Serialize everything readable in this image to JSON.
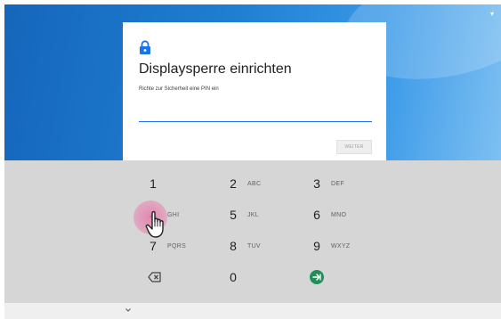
{
  "dialog": {
    "title": "Displaysperre einrichten",
    "subtitle": "Richte zur Sicherheit eine PIN ein",
    "pin_value": "",
    "next_label": "WEITER"
  },
  "keypad": {
    "keys": [
      {
        "num": "1",
        "letters": ""
      },
      {
        "num": "2",
        "letters": "ABC"
      },
      {
        "num": "3",
        "letters": "DEF"
      },
      {
        "num": "4",
        "letters": "GHI"
      },
      {
        "num": "5",
        "letters": "JKL"
      },
      {
        "num": "6",
        "letters": "MNO"
      },
      {
        "num": "7",
        "letters": "PQRS"
      },
      {
        "num": "8",
        "letters": "TUV"
      },
      {
        "num": "9",
        "letters": "WXYZ"
      },
      {
        "num": "0",
        "letters": ""
      }
    ]
  },
  "colors": {
    "accent": "#1a73e8",
    "enter_key": "#1e8e5a",
    "touch_highlight": "#e878aa",
    "wallpaper": "#1f7fd3"
  },
  "icons": {
    "lock": "lock-icon",
    "backspace": "backspace-icon",
    "enter": "enter-icon",
    "chevron": "chevron-down-icon",
    "wifi": "wifi-icon",
    "cursor": "hand-pointer-icon"
  }
}
